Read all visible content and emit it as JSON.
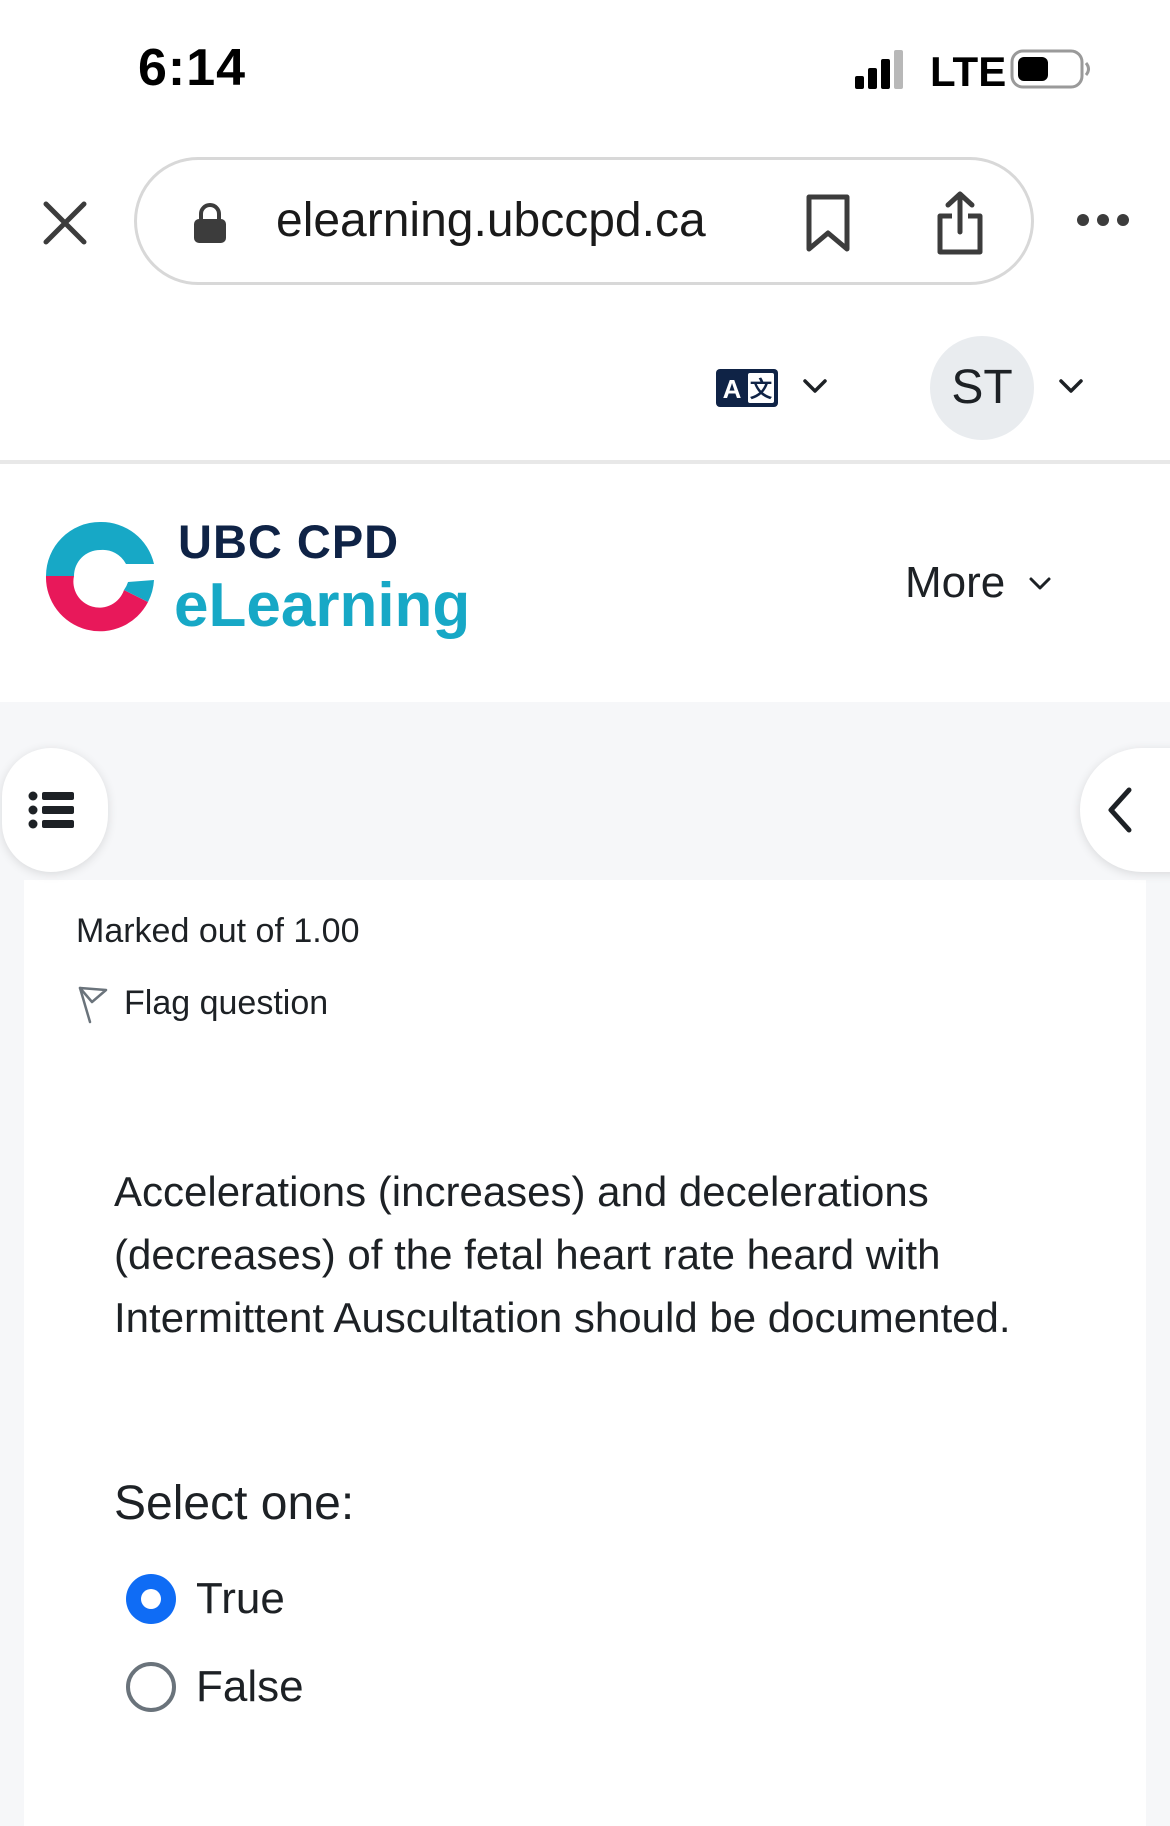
{
  "status_bar": {
    "time": "6:14",
    "network": "LTE"
  },
  "browser": {
    "url": "elearning.ubccpd.ca",
    "icons": [
      "close-icon",
      "lock-icon",
      "bookmark-icon",
      "share-icon",
      "more-horizontal-icon"
    ]
  },
  "top_bar": {
    "language_icon": "translate-icon",
    "user_initials": "ST"
  },
  "navbar": {
    "logo_line1": "UBC CPD",
    "logo_line2": "eLearning",
    "more_label": "More",
    "colors": {
      "navy": "#0f2346",
      "teal": "#17a8c6",
      "pink": "#e8185a"
    }
  },
  "question": {
    "marked_out": "Marked out of 1.00",
    "flag_label": "Flag question",
    "text": "Accelerations (increases) and decelerations (decreases) of the fetal heart rate heard with Intermittent Auscultation should be documented.",
    "prompt": "Select one:",
    "options": [
      {
        "label": "True",
        "selected": true
      },
      {
        "label": "False",
        "selected": false
      }
    ]
  },
  "accent_color": "#0f6cf5"
}
